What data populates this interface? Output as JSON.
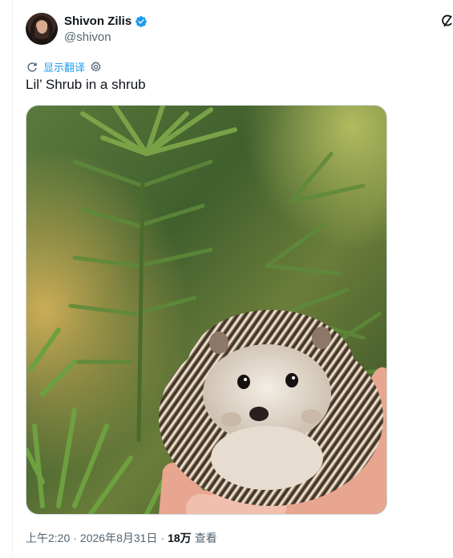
{
  "author": {
    "display_name": "Shivon Zilis",
    "handle": "@shivon"
  },
  "icons": {
    "verified": "verified-badge-icon",
    "translate": "translate-icon",
    "settings": "gear-icon",
    "grok": "grok-icon"
  },
  "colors": {
    "accent": "#1d9bf0",
    "secondary_text": "#536471"
  },
  "translate_label": "显示翻译",
  "tweet": {
    "text": "Lil’ Shrub in a shrub"
  },
  "media": {
    "alt": "Hedgehog held in a hand among green shrub leaves"
  },
  "meta": {
    "time": "上午2:20",
    "separator1": "·",
    "date": "2026年8月31日",
    "separator2": "·",
    "views_count": "18万",
    "views_label": "查看"
  }
}
